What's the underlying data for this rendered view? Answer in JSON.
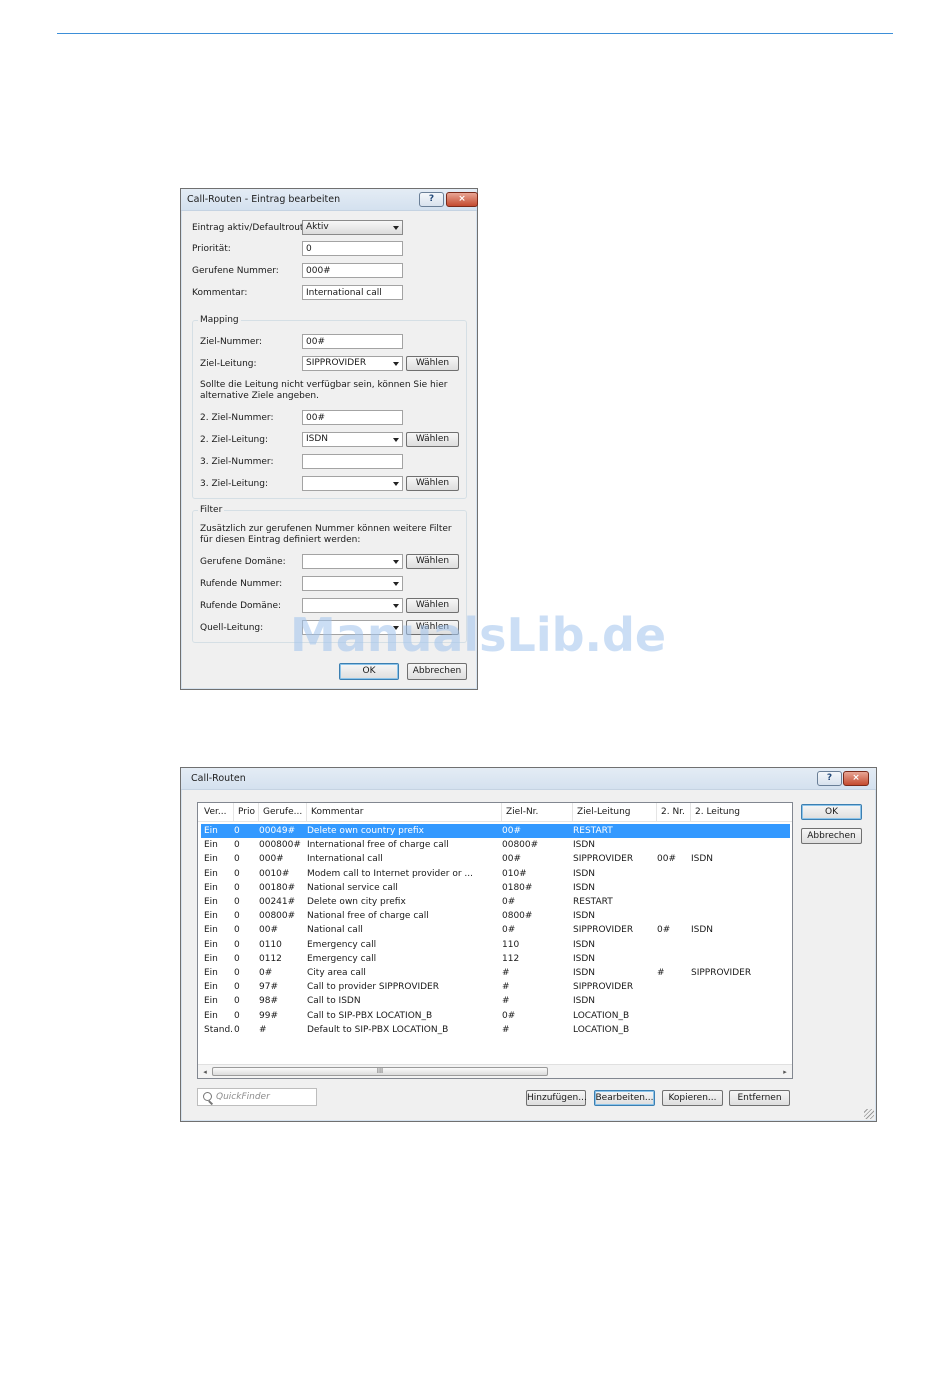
{
  "dialog1": {
    "title": "Call-Routen - Eintrag bearbeiten",
    "help": "?",
    "close": "×",
    "fields": {
      "eintrag_label": "Eintrag aktiv/Defaultroute:",
      "eintrag_value": "Aktiv",
      "prio_label": "Priorität:",
      "prio_value": "0",
      "nummer_label": "Gerufene Nummer:",
      "nummer_value": "000#",
      "kommentar_label": "Kommentar:",
      "kommentar_value": "International call"
    },
    "mapping": {
      "title": "Mapping",
      "ziel_nummer_label": "Ziel-Nummer:",
      "ziel_nummer_value": "00#",
      "ziel_leitung_label": "Ziel-Leitung:",
      "ziel_leitung_value": "SIPPROVIDER",
      "hint": "Sollte die Leitung nicht verfügbar sein, können Sie hier alternative Ziele angeben.",
      "ziel2_nummer_label": "2. Ziel-Nummer:",
      "ziel2_nummer_value": "00#",
      "ziel2_leitung_label": "2. Ziel-Leitung:",
      "ziel2_leitung_value": "ISDN",
      "ziel3_nummer_label": "3. Ziel-Nummer:",
      "ziel3_nummer_value": "",
      "ziel3_leitung_label": "3. Ziel-Leitung:",
      "ziel3_leitung_value": ""
    },
    "filter": {
      "title": "Filter",
      "hint": "Zusätzlich zur gerufenen Nummer können weitere Filter für diesen Eintrag definiert werden:",
      "domain_label": "Gerufene Domäne:",
      "rufende_label": "Rufende Nummer:",
      "rufende_domain_label": "Rufende Domäne:",
      "quell_label": "Quell-Leitung:"
    },
    "choose": "Wählen",
    "ok": "OK",
    "cancel": "Abbrechen"
  },
  "dialog2": {
    "title": "Call-Routen",
    "help": "?",
    "close": "×",
    "columns": [
      "Ver...",
      "Prio",
      "Gerufe...",
      "Kommentar",
      "Ziel-Nr.",
      "Ziel-Leitung",
      "2. Nr.",
      "2. Leitung"
    ],
    "rows": [
      [
        "Ein",
        "0",
        "00049#",
        "Delete own country prefix",
        "00#",
        "RESTART",
        "",
        ""
      ],
      [
        "Ein",
        "0",
        "000800#",
        "International free of charge call",
        "00800#",
        "ISDN",
        "",
        ""
      ],
      [
        "Ein",
        "0",
        "000#",
        "International call",
        "00#",
        "SIPPROVIDER",
        "00#",
        "ISDN"
      ],
      [
        "Ein",
        "0",
        "0010#",
        "Modem call to Internet provider or ...",
        "010#",
        "ISDN",
        "",
        ""
      ],
      [
        "Ein",
        "0",
        "00180#",
        "National service call",
        "0180#",
        "ISDN",
        "",
        ""
      ],
      [
        "Ein",
        "0",
        "00241#",
        "Delete own city prefix",
        "0#",
        "RESTART",
        "",
        ""
      ],
      [
        "Ein",
        "0",
        "00800#",
        "National free of charge call",
        "0800#",
        "ISDN",
        "",
        ""
      ],
      [
        "Ein",
        "0",
        "00#",
        "National call",
        "0#",
        "SIPPROVIDER",
        "0#",
        "ISDN"
      ],
      [
        "Ein",
        "0",
        "0110",
        "Emergency call",
        "110",
        "ISDN",
        "",
        ""
      ],
      [
        "Ein",
        "0",
        "0112",
        "Emergency call",
        "112",
        "ISDN",
        "",
        ""
      ],
      [
        "Ein",
        "0",
        "0#",
        "City area call",
        "#",
        "ISDN",
        "#",
        "SIPPROVIDER"
      ],
      [
        "Ein",
        "0",
        "97#",
        "Call to provider SIPPROVIDER",
        "#",
        "SIPPROVIDER",
        "",
        ""
      ],
      [
        "Ein",
        "0",
        "98#",
        "Call to ISDN",
        "#",
        "ISDN",
        "",
        ""
      ],
      [
        "Ein",
        "0",
        "99#",
        "Call to SIP-PBX LOCATION_B",
        "0#",
        "LOCATION_B",
        "",
        ""
      ],
      [
        "Stand...",
        "0",
        "#",
        "Default to SIP-PBX LOCATION_B",
        "#",
        "LOCATION_B",
        "",
        ""
      ]
    ],
    "scroll_grip": "III",
    "scroll_left": "◂",
    "scroll_right": "▸",
    "search_placeholder": "QuickFinder",
    "add": "Hinzufügen...",
    "edit": "Bearbeiten...",
    "copy": "Kopieren...",
    "remove": "Entfernen",
    "ok": "OK",
    "cancel": "Abbrechen"
  },
  "watermark": "ManualsLib.de"
}
